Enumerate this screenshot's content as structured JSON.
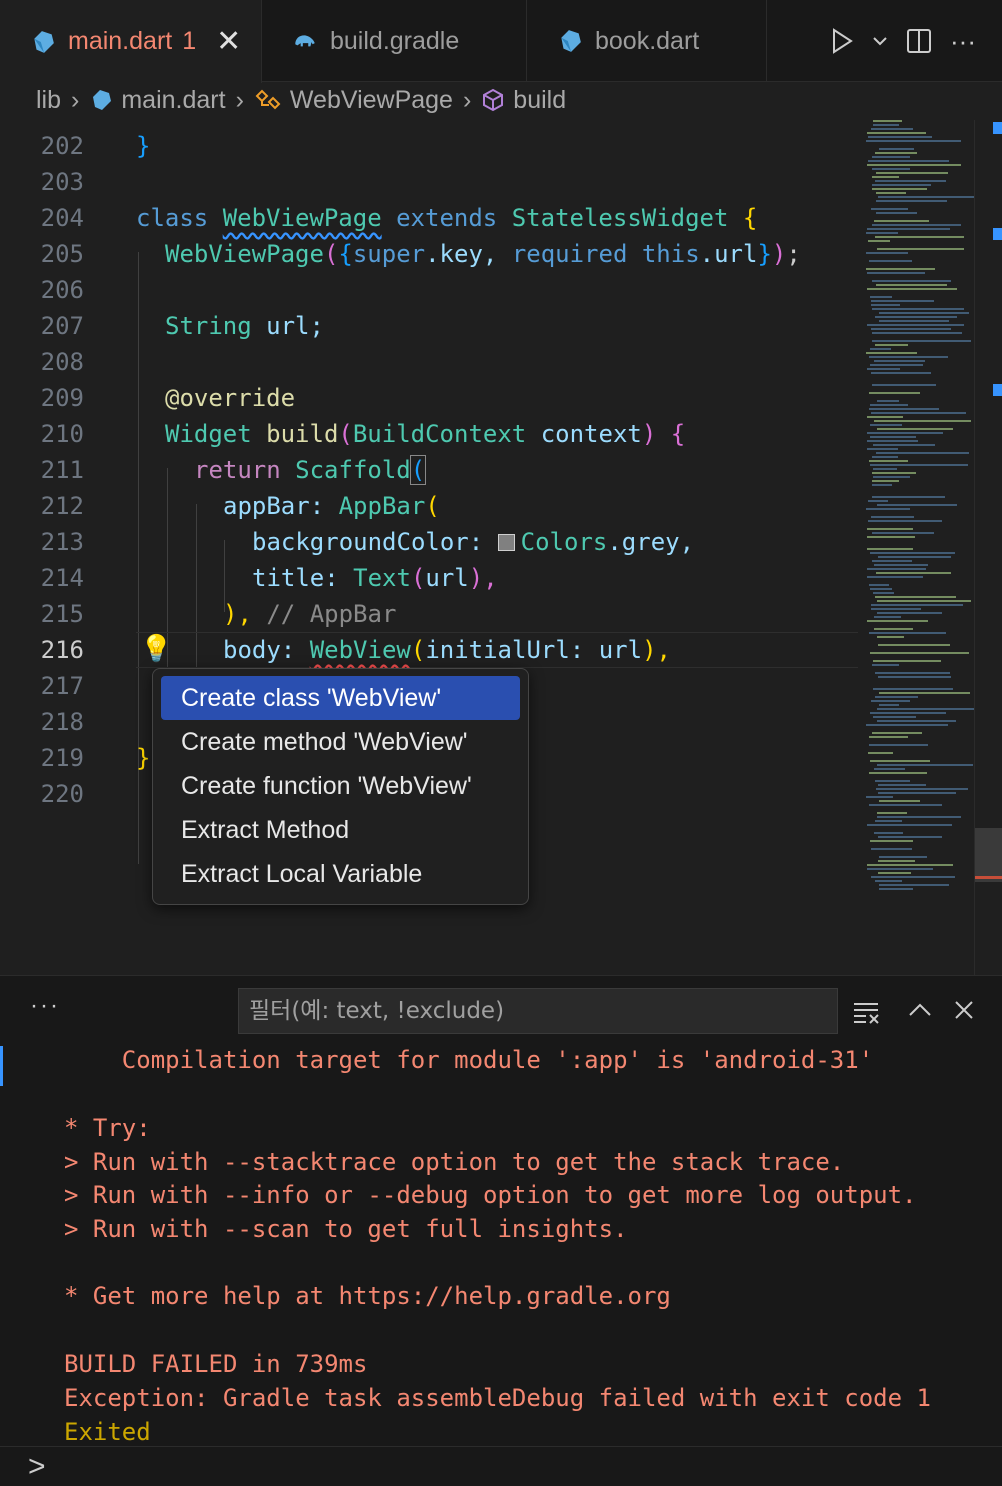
{
  "tabs": [
    {
      "label": "main.dart",
      "badge": "1",
      "active": true
    },
    {
      "label": "build.gradle",
      "active": false
    },
    {
      "label": "book.dart",
      "active": false
    }
  ],
  "tab_actions": {
    "run_icon": "play-icon",
    "dropdown_icon": "chevron-down-icon",
    "split_icon": "split-editor-icon",
    "more_icon": "more-icon",
    "more_text": "···"
  },
  "breadcrumb": [
    "lib",
    "main.dart",
    "WebViewPage",
    "build"
  ],
  "editor": {
    "current_line": 216,
    "lines": [
      {
        "n": "202"
      },
      {
        "n": "203"
      },
      {
        "n": "204"
      },
      {
        "n": "205"
      },
      {
        "n": "206"
      },
      {
        "n": "207"
      },
      {
        "n": "208"
      },
      {
        "n": "209"
      },
      {
        "n": "210"
      },
      {
        "n": "211"
      },
      {
        "n": "212"
      },
      {
        "n": "213"
      },
      {
        "n": "214"
      },
      {
        "n": "215"
      },
      {
        "n": "216"
      },
      {
        "n": "217"
      },
      {
        "n": "218"
      },
      {
        "n": "219"
      },
      {
        "n": "220"
      }
    ],
    "code": {
      "l202": "}",
      "l204_kw": "class",
      "l204_name": "WebViewPage",
      "l204_ext": "extends",
      "l204_base": "StatelessWidget",
      "l204_br": "{",
      "l205_ctor": "WebViewPage",
      "l205_rest_a": "(",
      "l205_rest_b": "{",
      "l205_super": "super",
      "l205_key": ".key, ",
      "l205_req": "required",
      "l205_this": "this",
      "l205_url": ".url",
      "l205_end_a": "}",
      "l205_end_b": ")",
      "l205_semi": ";",
      "l207_type": "String",
      "l207_var": "url;",
      "l209": "@override",
      "l210_type": "Widget",
      "l210_fn": "build",
      "l210_p1": "(",
      "l210_ptype": "BuildContext",
      "l210_pname": "context",
      "l210_p2": ")",
      "l210_br": "{",
      "l211_kw": "return",
      "l211_cls": "Scaffold",
      "l211_p": "(",
      "l212_key": "appBar:",
      "l212_cls": "AppBar",
      "l212_p": "(",
      "l213_key": "backgroundColor:",
      "l213_val": "Colors",
      "l213_prop": ".grey,",
      "l214_key": "title:",
      "l214_cls": "Text",
      "l214_p1": "(",
      "l214_arg": "url",
      "l214_p2": "),",
      "l215_p": "),",
      "l215_cm": "// AppBar",
      "l216_key": "body:",
      "l216_cls": "WebView",
      "l216_p1": "(",
      "l216_arg": "initialUrl:",
      "l216_val": "url",
      "l216_p2": "),",
      "l219": "}"
    }
  },
  "code_actions": [
    "Create class 'WebView'",
    "Create method 'WebView'",
    "Create function 'WebView'",
    "Extract Method",
    "Extract Local Variable"
  ],
  "panel": {
    "more_label": "···",
    "filter_placeholder": "필터(예: text, !exclude)",
    "output": [
      {
        "text": "    Compilation target for module ':app' is 'android-31'",
        "kind": "error"
      },
      {
        "text": "",
        "kind": "error"
      },
      {
        "text": "* Try:",
        "kind": "error"
      },
      {
        "text": "> Run with --stacktrace option to get the stack trace.",
        "kind": "error"
      },
      {
        "text": "> Run with --info or --debug option to get more log output.",
        "kind": "error"
      },
      {
        "text": "> Run with --scan to get full insights.",
        "kind": "error"
      },
      {
        "text": "",
        "kind": "error"
      },
      {
        "text": "* Get more help at https://help.gradle.org",
        "kind": "error"
      },
      {
        "text": "",
        "kind": "error"
      },
      {
        "text": "BUILD FAILED in 739ms",
        "kind": "error"
      },
      {
        "text": "Exception: Gradle task assembleDebug failed with exit code 1",
        "kind": "error"
      },
      {
        "text": "Exited",
        "kind": "warn"
      }
    ],
    "prompt": ">"
  },
  "colors": {
    "accent": "#3794ff",
    "error": "#f48771",
    "warning": "#cca700",
    "selection": "#2a4fb0"
  }
}
